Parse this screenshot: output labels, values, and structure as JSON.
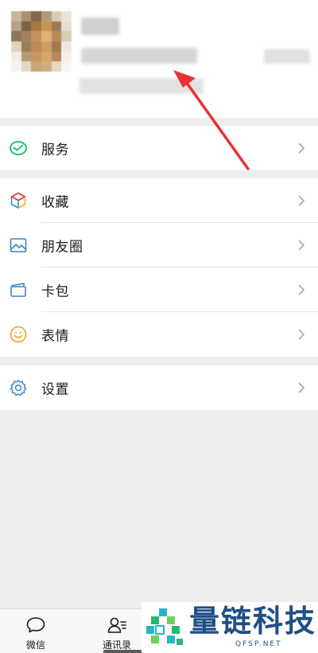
{
  "menu": {
    "services": {
      "label": "服务",
      "icon": "wechat-pay-icon"
    },
    "collections": {
      "label": "收藏",
      "icon": "cube-icon"
    },
    "moments": {
      "label": "朋友圈",
      "icon": "picture-icon"
    },
    "cards": {
      "label": "卡包",
      "icon": "wallet-card-icon"
    },
    "stickers": {
      "label": "表情",
      "icon": "smiley-icon"
    },
    "settings": {
      "label": "设置",
      "icon": "gear-icon"
    }
  },
  "tabbar": {
    "tabs": [
      {
        "label": "微信",
        "icon": "chat-bubble-icon"
      },
      {
        "label": "通讯录",
        "icon": "contacts-icon"
      }
    ]
  },
  "watermark": {
    "text": "量链科技",
    "sub": "QFSP.NET"
  },
  "colors": {
    "accent_green": "#07c160",
    "arrow_red": "#e8322f",
    "icon_blue": "#3a86c8",
    "watermark_blue": "#1f4f86"
  }
}
